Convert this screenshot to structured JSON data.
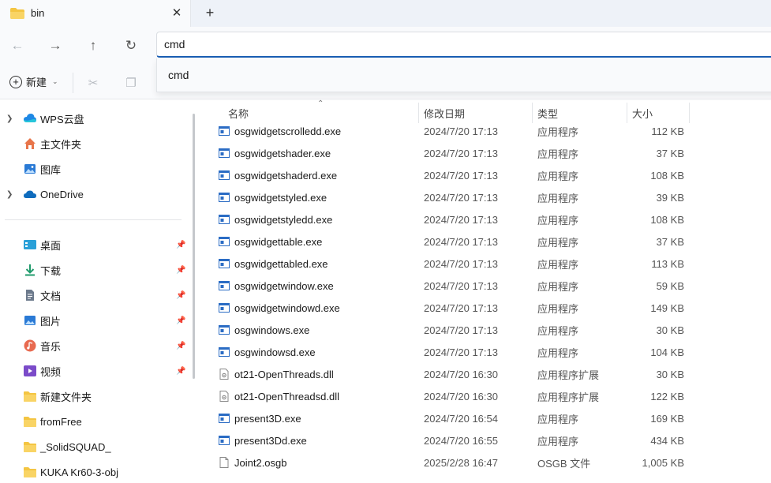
{
  "tab": {
    "title": "bin",
    "close_icon": "close-icon",
    "new_tab_icon": "plus-icon"
  },
  "nav": {
    "back": "back-arrow-icon",
    "forward": "forward-arrow-icon",
    "up": "up-arrow-icon",
    "refresh": "refresh-icon"
  },
  "address": {
    "value": "cmd",
    "suggestion": "cmd"
  },
  "toolbar": {
    "new_label": "新建",
    "cut_icon": "cut-icon",
    "copy_icon": "copy-icon"
  },
  "sidebar": {
    "items": [
      {
        "label": "WPS云盘",
        "icon": "cloud-icon",
        "expandable": true
      },
      {
        "label": "主文件夹",
        "icon": "home-icon",
        "expandable": false
      },
      {
        "label": "图库",
        "icon": "gallery-icon",
        "expandable": false
      },
      {
        "label": "OneDrive",
        "icon": "onedrive-icon",
        "expandable": true
      }
    ],
    "quick_access": [
      {
        "label": "桌面",
        "icon": "desktop-icon",
        "pinned": true
      },
      {
        "label": "下载",
        "icon": "download-icon",
        "pinned": true
      },
      {
        "label": "文档",
        "icon": "document-icon",
        "pinned": true
      },
      {
        "label": "图片",
        "icon": "pictures-icon",
        "pinned": true
      },
      {
        "label": "音乐",
        "icon": "music-icon",
        "pinned": true
      },
      {
        "label": "视频",
        "icon": "video-icon",
        "pinned": true
      },
      {
        "label": "新建文件夹",
        "icon": "folder-icon",
        "pinned": false
      },
      {
        "label": "fromFree",
        "icon": "folder-icon",
        "pinned": false
      },
      {
        "label": "_SolidSQUAD_",
        "icon": "folder-icon",
        "pinned": false
      },
      {
        "label": "KUKA Kr60-3-obj",
        "icon": "folder-icon",
        "pinned": false
      }
    ]
  },
  "columns": {
    "name": "名称",
    "date": "修改日期",
    "type": "类型",
    "size": "大小"
  },
  "files": [
    {
      "name": "osgwidgetscrolledd.exe",
      "date": "2024/7/20 17:13",
      "type": "应用程序",
      "size": "112 KB",
      "kind": "exe"
    },
    {
      "name": "osgwidgetshader.exe",
      "date": "2024/7/20 17:13",
      "type": "应用程序",
      "size": "37 KB",
      "kind": "exe"
    },
    {
      "name": "osgwidgetshaderd.exe",
      "date": "2024/7/20 17:13",
      "type": "应用程序",
      "size": "108 KB",
      "kind": "exe"
    },
    {
      "name": "osgwidgetstyled.exe",
      "date": "2024/7/20 17:13",
      "type": "应用程序",
      "size": "39 KB",
      "kind": "exe"
    },
    {
      "name": "osgwidgetstyledd.exe",
      "date": "2024/7/20 17:13",
      "type": "应用程序",
      "size": "108 KB",
      "kind": "exe"
    },
    {
      "name": "osgwidgettable.exe",
      "date": "2024/7/20 17:13",
      "type": "应用程序",
      "size": "37 KB",
      "kind": "exe"
    },
    {
      "name": "osgwidgettabled.exe",
      "date": "2024/7/20 17:13",
      "type": "应用程序",
      "size": "113 KB",
      "kind": "exe"
    },
    {
      "name": "osgwidgetwindow.exe",
      "date": "2024/7/20 17:13",
      "type": "应用程序",
      "size": "59 KB",
      "kind": "exe"
    },
    {
      "name": "osgwidgetwindowd.exe",
      "date": "2024/7/20 17:13",
      "type": "应用程序",
      "size": "149 KB",
      "kind": "exe"
    },
    {
      "name": "osgwindows.exe",
      "date": "2024/7/20 17:13",
      "type": "应用程序",
      "size": "30 KB",
      "kind": "exe"
    },
    {
      "name": "osgwindowsd.exe",
      "date": "2024/7/20 17:13",
      "type": "应用程序",
      "size": "104 KB",
      "kind": "exe"
    },
    {
      "name": "ot21-OpenThreads.dll",
      "date": "2024/7/20 16:30",
      "type": "应用程序扩展",
      "size": "30 KB",
      "kind": "dll"
    },
    {
      "name": "ot21-OpenThreadsd.dll",
      "date": "2024/7/20 16:30",
      "type": "应用程序扩展",
      "size": "122 KB",
      "kind": "dll"
    },
    {
      "name": "present3D.exe",
      "date": "2024/7/20 16:54",
      "type": "应用程序",
      "size": "169 KB",
      "kind": "exe"
    },
    {
      "name": "present3Dd.exe",
      "date": "2024/7/20 16:55",
      "type": "应用程序",
      "size": "434 KB",
      "kind": "exe"
    },
    {
      "name": "Joint2.osgb",
      "date": "2025/2/28 16:47",
      "type": "OSGB 文件",
      "size": "1,005 KB",
      "kind": "file"
    }
  ],
  "colors": {
    "accent": "#1a5fb4",
    "folder": "#f4c542",
    "exe": "#2b6cc4"
  }
}
